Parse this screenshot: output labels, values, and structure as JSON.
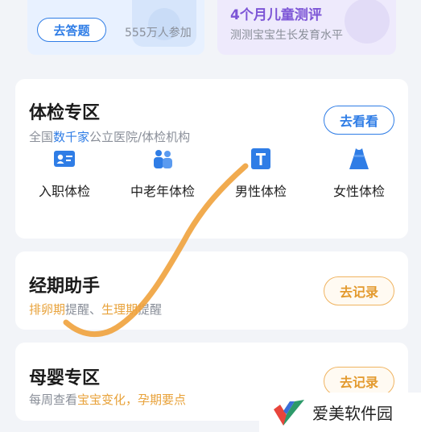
{
  "top_cards": {
    "quiz_button": "去答题",
    "participants": "555万人参加",
    "eval_title": "4个月儿童测评",
    "eval_subtitle": "测测宝宝生长发育水平"
  },
  "physical_exam": {
    "title": "体检专区",
    "subtitle_prefix": "全国",
    "subtitle_highlight": "数千家",
    "subtitle_suffix": "公立医院/体检机构",
    "action_button": "去看看",
    "items": [
      {
        "label": "入职体检",
        "icon": "id-card-icon"
      },
      {
        "label": "中老年体检",
        "icon": "elderly-couple-icon"
      },
      {
        "label": "男性体检",
        "icon": "male-icon"
      },
      {
        "label": "女性体检",
        "icon": "dress-icon"
      }
    ]
  },
  "period_assistant": {
    "title": "经期助手",
    "sub_part1": "排卵期",
    "sub_part2": "提醒、",
    "sub_part3": "生理期",
    "sub_part4": "提醒",
    "action_button": "去记录"
  },
  "maternal": {
    "title": "母婴专区",
    "sub_prefix": "每周查看",
    "sub_highlight": "宝宝变化，孕期要点",
    "action_button": "去记录"
  },
  "watermark": {
    "text": "爱美软件园"
  },
  "colors": {
    "accent_blue": "#2f7de6",
    "accent_orange": "#e8a23a",
    "accent_purple": "#7c55d6",
    "scribble": "#f0a23c"
  }
}
